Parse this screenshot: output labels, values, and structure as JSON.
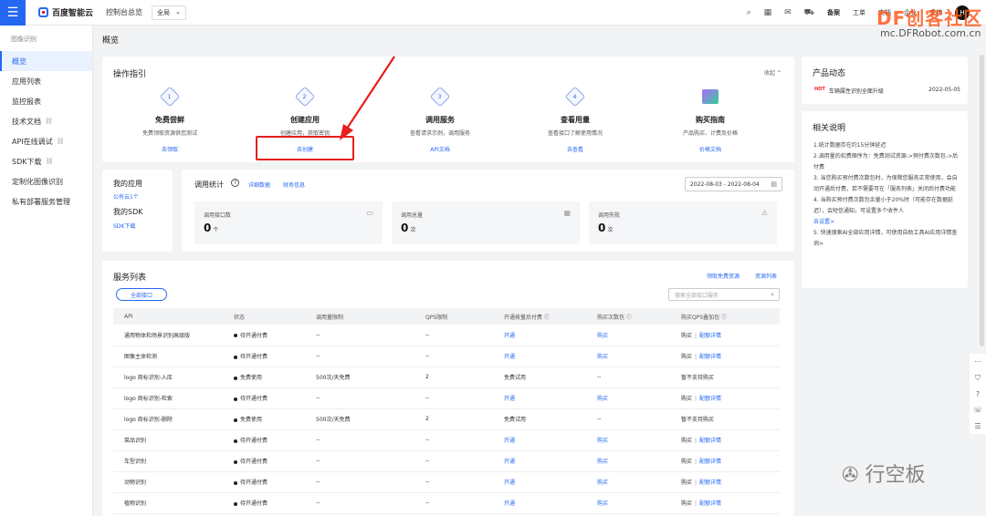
{
  "topbar": {
    "brand": "百度智能云",
    "console": "控制台总览",
    "region": "全局",
    "links": [
      "备案",
      "工单",
      "文档",
      "企业",
      "支持"
    ],
    "avatar": "H"
  },
  "watermarks": {
    "top": "DF创客社区",
    "top_url": "mc.DFRobot.com.cn",
    "bottom": "行空板"
  },
  "sidebar": {
    "title": "图像识别",
    "items": [
      {
        "label": "概览"
      },
      {
        "label": "应用列表"
      },
      {
        "label": "监控报表"
      },
      {
        "label": "技术文档"
      },
      {
        "label": "API在线调试"
      },
      {
        "label": "SDK下载"
      },
      {
        "label": "定制化图像识别"
      },
      {
        "label": "私有部署服务管理"
      }
    ]
  },
  "page": {
    "title": "概览"
  },
  "guide": {
    "title": "操作指引",
    "collapse": "收起",
    "steps": [
      {
        "num": "1",
        "title": "免费尝鲜",
        "desc": "免费领取资源供您测试",
        "link": "去领取"
      },
      {
        "num": "2",
        "title": "创建应用",
        "desc": "创建应用，获取密钥",
        "link": "去创建"
      },
      {
        "num": "3",
        "title": "调用服务",
        "desc": "查看请求示例，调用服务",
        "link": "API文档"
      },
      {
        "num": "4",
        "title": "查看用量",
        "desc": "查看接口了解使用情况",
        "link": "去查看"
      },
      {
        "num": "",
        "title": "购买指南",
        "desc": "产品购买、计费及价格",
        "link": "价格文档"
      }
    ]
  },
  "news": {
    "title": "产品动态",
    "items": [
      {
        "tag": "HOT",
        "text": "车辆属性识别全面升级",
        "date": "2022-05-05"
      }
    ]
  },
  "notes": {
    "title": "相关说明",
    "lines": [
      "1.统计数据存在约15分钟延迟",
      "2.调用量的扣费顺序为：免费测试资源->预付费次数包->后付费",
      "3. 当您购买预付费次数包时，为保障您服务正常使用，会自动开通后付费，若不需要可在「服务列表」关闭后付费功能",
      "4. 当购买预付费次数包余量小于20%时（可能存在数据延迟），会短信通知，可设置多个收件人",
      "去设置>",
      "5. 快速搜索AI全部应用详情，可使用自助工具AI应用详情查询>"
    ]
  },
  "myapp": {
    "title": "我的应用",
    "count_link": "公有云1个",
    "sdk_title": "我的SDK",
    "sdk_link": "SDK下载"
  },
  "stats": {
    "title": "调用统计",
    "help": "?",
    "link_detail": "详细数据",
    "link_finance": "财务信息",
    "date_range": "2022-08-03 - 2022-08-04",
    "cards": [
      {
        "label": "调用接口数",
        "value": "0",
        "unit": "个"
      },
      {
        "label": "调用总量",
        "value": "0",
        "unit": "次"
      },
      {
        "label": "调用失败",
        "value": "0",
        "unit": "次"
      }
    ]
  },
  "services": {
    "title": "服务列表",
    "link_free": "领取免费资源",
    "link_price": "资源列表",
    "filter": "全部接口",
    "search_placeholder": "搜索全部接口服务",
    "columns": [
      "API",
      "状态",
      "调用量限制",
      "QPS限制",
      "开通按量后付费 ⓘ",
      "购买次数包 ⓘ",
      "购买QPS叠加包 ⓘ"
    ],
    "rows": [
      {
        "api": "通用物体和场景识别高级版",
        "status": "待开通付费",
        "limit": "--",
        "qps": "--",
        "postpay": "开通",
        "pack": "购买",
        "qpspack": "购买",
        "detail": "配额详情"
      },
      {
        "api": "图像主体检测",
        "status": "待开通付费",
        "limit": "--",
        "qps": "--",
        "postpay": "开通",
        "pack": "购买",
        "qpspack": "购买",
        "detail": "配额详情"
      },
      {
        "api": "logo 商标识别-入库",
        "status": "免费使用",
        "limit": "500次/天免费",
        "qps": "2",
        "postpay": "免费试用",
        "pack": "--",
        "qpspack": "暂不支持购买",
        "detail": ""
      },
      {
        "api": "logo 商标识别-检索",
        "status": "待开通付费",
        "limit": "--",
        "qps": "--",
        "postpay": "开通",
        "pack": "购买",
        "qpspack": "购买",
        "detail": "配额详情"
      },
      {
        "api": "logo 商标识别-删除",
        "status": "免费使用",
        "limit": "500次/天免费",
        "qps": "2",
        "postpay": "免费试用",
        "pack": "--",
        "qpspack": "暂不支持购买",
        "detail": ""
      },
      {
        "api": "菜品识别",
        "status": "待开通付费",
        "limit": "--",
        "qps": "--",
        "postpay": "开通",
        "pack": "购买",
        "qpspack": "购买",
        "detail": "配额详情"
      },
      {
        "api": "车型识别",
        "status": "待开通付费",
        "limit": "--",
        "qps": "--",
        "postpay": "开通",
        "pack": "购买",
        "qpspack": "购买",
        "detail": "配额详情"
      },
      {
        "api": "动物识别",
        "status": "待开通付费",
        "limit": "--",
        "qps": "--",
        "postpay": "开通",
        "pack": "购买",
        "qpspack": "购买",
        "detail": "配额详情"
      },
      {
        "api": "植物识别",
        "status": "待开通付费",
        "limit": "--",
        "qps": "--",
        "postpay": "开通",
        "pack": "购买",
        "qpspack": "购买",
        "detail": "配额详情"
      }
    ]
  },
  "colors": {
    "accent": "#2468f2",
    "annotation": "#e81e1e"
  }
}
